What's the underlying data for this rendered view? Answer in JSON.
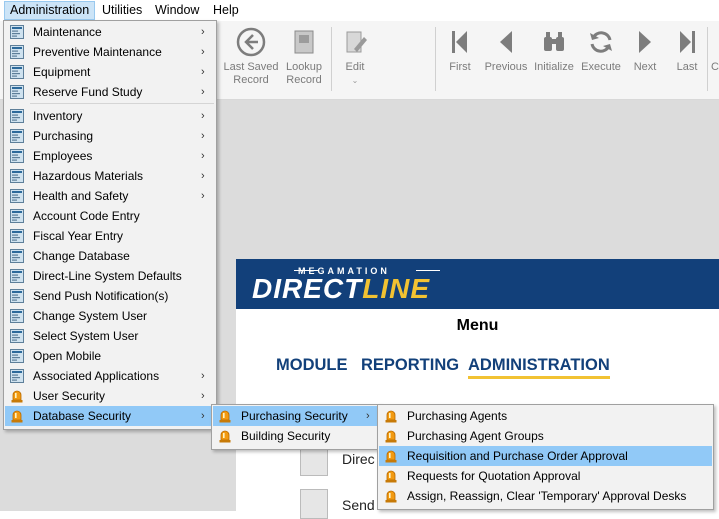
{
  "menubar": {
    "items": [
      "Administration",
      "Utilities",
      "Window",
      "Help"
    ]
  },
  "toolbar": {
    "last_saved": "Last Saved\nRecord",
    "lookup": "Lookup\nRecord",
    "edit": "Edit",
    "first": "First",
    "previous": "Previous",
    "initialize": "Initialize",
    "execute": "Execute",
    "next": "Next",
    "last": "Last",
    "clipped": "C"
  },
  "admin_menu": {
    "items": [
      {
        "label": "Maintenance",
        "icon": "form-icon",
        "submenu": true
      },
      {
        "label": "Preventive Maintenance",
        "icon": "form-icon",
        "submenu": true
      },
      {
        "label": "Equipment",
        "icon": "form-icon",
        "submenu": true
      },
      {
        "label": "Reserve Fund Study",
        "icon": "form-icon",
        "submenu": true
      },
      {
        "label": "Inventory",
        "icon": "form-icon",
        "submenu": true
      },
      {
        "label": "Purchasing",
        "icon": "form-icon",
        "submenu": true
      },
      {
        "label": "Employees",
        "icon": "form-icon",
        "submenu": true
      },
      {
        "label": "Hazardous Materials",
        "icon": "form-icon",
        "submenu": true
      },
      {
        "label": "Health and Safety",
        "icon": "form-icon",
        "submenu": true
      },
      {
        "label": "Account Code Entry",
        "icon": "form-icon",
        "submenu": false
      },
      {
        "label": "Fiscal Year Entry",
        "icon": "form-icon",
        "submenu": false
      },
      {
        "label": "Change Database",
        "icon": "form-icon",
        "submenu": false
      },
      {
        "label": "Direct-Line System Defaults",
        "icon": "form-icon",
        "submenu": false
      },
      {
        "label": "Send Push Notification(s)",
        "icon": "form-icon",
        "submenu": false
      },
      {
        "label": "Change System User",
        "icon": "form-icon",
        "submenu": false
      },
      {
        "label": "Select System User",
        "icon": "form-icon",
        "submenu": false
      },
      {
        "label": "Open Mobile",
        "icon": "form-icon",
        "submenu": false
      },
      {
        "label": "Associated Applications",
        "icon": "form-icon",
        "submenu": true
      },
      {
        "label": "User Security",
        "icon": "alarm-icon",
        "submenu": true
      },
      {
        "label": "Database Security",
        "icon": "alarm-icon",
        "submenu": true
      }
    ]
  },
  "db_security_menu": {
    "items": [
      {
        "label": "Purchasing Security",
        "submenu": true
      },
      {
        "label": "Building Security",
        "submenu": false
      }
    ]
  },
  "purchasing_security_menu": {
    "items": [
      {
        "label": "Purchasing Agents"
      },
      {
        "label": "Purchasing Agent Groups"
      },
      {
        "label": "Requisition and Purchase Order Approval"
      },
      {
        "label": "Requests for Quotation Approval"
      },
      {
        "label": "Assign, Reassign, Clear 'Temporary' Approval Desks"
      }
    ]
  },
  "directline": {
    "brand_top": "MEGAMATION",
    "brand_direct": "DIRECT",
    "brand_line": "LINE",
    "menu_title": "Menu",
    "tabs": [
      "MODULE",
      "REPORTING",
      "ADMINISTRATION"
    ],
    "items": [
      "Direc",
      "Send Push Notification"
    ]
  },
  "colors": {
    "highlight": "#91c9f7",
    "brand_blue": "#12407a",
    "brand_yellow": "#f2c232",
    "alarm_orange": "#f29a12"
  }
}
